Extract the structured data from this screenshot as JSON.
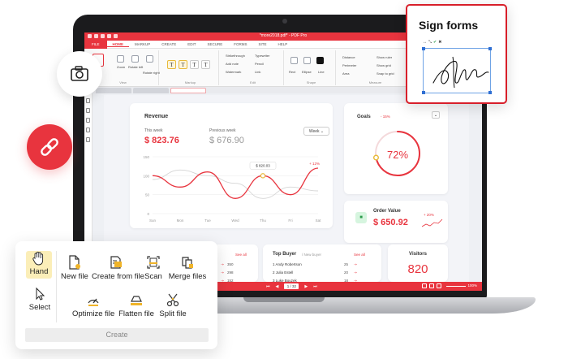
{
  "app": {
    "window_title": "*more2018.pdf* - PDF Pro",
    "file_tab": "FILE",
    "tabs": [
      "HOME",
      "MARKUP",
      "CREATE",
      "EDIT",
      "SECURE",
      "FORMS",
      "SITE",
      "HELP"
    ],
    "active_tab": "HOME"
  },
  "ribbon": {
    "view_group": "View",
    "markup_group": "Markup",
    "edit_group": "Edit",
    "shape_group": "Shape",
    "measure_group": "Measure",
    "zoom_label": "Zoom",
    "rotate_left": "Rotate left",
    "rotate_right": "Rotate right",
    "edit_items": [
      "Strikethrough",
      "Add note",
      "Watermark",
      "Typewriter",
      "Pencil",
      "Link"
    ],
    "shape_items": [
      "Rect",
      "Ellipse",
      "Line"
    ],
    "measure_items": [
      "Distance",
      "Perimeter",
      "Area",
      "Show ruler",
      "Show grid",
      "Snap to grid"
    ],
    "subscription_label": "Subscription info"
  },
  "dashboard": {
    "revenue": {
      "title": "Revenue",
      "this_week_label": "This week",
      "this_week_value": "$ 823.76",
      "previous_label": "Previous week",
      "previous_value": "$ 676.90",
      "period": "Week",
      "tooltip": "$ 820.03",
      "change": "+ 12%"
    },
    "goals": {
      "title": "Goals",
      "change": "- 15%",
      "value": "72%",
      "progress": 72
    },
    "order_value": {
      "title": "Order Value",
      "value": "$ 650.92",
      "change": "+ 20%"
    },
    "top_buyer": {
      "title": "Top Buyer",
      "subtitle": "/ New buyer",
      "see_all": "See all",
      "rows": [
        {
          "name": "1 Andy Robertson",
          "count": "25"
        },
        {
          "name": "2 Julia Estell",
          "count": "20"
        },
        {
          "name": "3 Luke Bouzek",
          "count": "18"
        }
      ]
    },
    "left_list": {
      "see_all": "See all",
      "values": [
        "350",
        "298",
        "152"
      ]
    },
    "visitors": {
      "title": "Visitors",
      "value": "820"
    }
  },
  "status": {
    "page": "1 / 32",
    "zoom": "100%"
  },
  "sign_forms": {
    "title": "Sign forms"
  },
  "create_panel": {
    "tools": {
      "hand": "Hand",
      "select": "Select",
      "new_file": "New file",
      "create_from_file": "Create from file",
      "scan": "Scan",
      "merge_files": "Merge files",
      "optimize_file": "Optimize file",
      "flatten_file": "Flatten file",
      "split_file": "Split file"
    },
    "group_label": "Create"
  },
  "chart_data": {
    "type": "line",
    "x": [
      "Sun",
      "Mon",
      "Tue",
      "Wed",
      "Thu",
      "Fri",
      "Sat"
    ],
    "y_ticks": [
      0,
      50,
      100,
      150
    ],
    "ylim": [
      0,
      150
    ],
    "series": [
      {
        "values": [
          100,
          70,
          110,
          40,
          100,
          50,
          120
        ]
      },
      {
        "values": [
          90,
          115,
          100,
          80,
          40,
          70,
          60
        ]
      }
    ]
  },
  "colors": {
    "accent": "#e8343e",
    "highlight": "#fbeeb8",
    "success": "#2b9a4b"
  }
}
